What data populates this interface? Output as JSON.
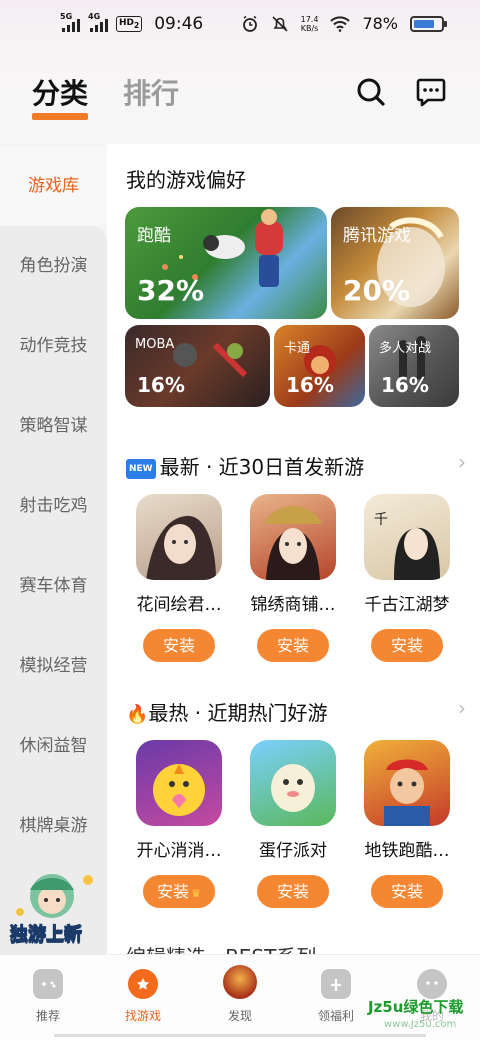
{
  "status_bar": {
    "sim1": "5G",
    "sim2": "4G",
    "hd": "HD",
    "hd_sub": "2",
    "time": "09:46",
    "speed_value": "17.4",
    "speed_unit": "KB/s",
    "battery": "78%"
  },
  "header": {
    "tabs": [
      {
        "label": "分类",
        "active": true
      },
      {
        "label": "排行",
        "active": false
      }
    ],
    "icons": [
      "search-icon",
      "message-icon"
    ]
  },
  "sidebar": {
    "items": [
      "游戏库",
      "角色扮演",
      "动作竞技",
      "策略智谋",
      "射击吃鸡",
      "赛车体育",
      "模拟经营",
      "休闲益智",
      "棋牌桌游"
    ],
    "active_index": 0,
    "badge_label": "独游上新"
  },
  "preference": {
    "title": "我的游戏偏好",
    "tiles": [
      {
        "name": "跑酷",
        "percent": "32%"
      },
      {
        "name": "腾讯游戏",
        "percent": "20%"
      },
      {
        "name": "MOBA",
        "percent": "16%"
      },
      {
        "name": "卡通",
        "percent": "16%"
      },
      {
        "name": "多人对战",
        "percent": "16%"
      }
    ]
  },
  "new_section": {
    "badge": "NEW",
    "title": "最新 · 近30日首发新游",
    "games": [
      {
        "name": "花间绘君…",
        "button": "安装"
      },
      {
        "name": "锦绣商铺…",
        "button": "安装"
      },
      {
        "name": "千古江湖梦",
        "button": "安装"
      }
    ]
  },
  "hot_section": {
    "emoji": "🔥",
    "title": "最热 · 近期热门好游",
    "games": [
      {
        "name": "开心消消…",
        "button": "安装",
        "crown": "♛"
      },
      {
        "name": "蛋仔派对",
        "button": "安装"
      },
      {
        "name": "地铁跑酷…",
        "button": "安装"
      }
    ]
  },
  "partial_section": {
    "title": "编辑精选 · BEST系列"
  },
  "bottom_nav": [
    {
      "label": "推荐"
    },
    {
      "label": "找游戏",
      "active": true
    },
    {
      "label": "发现"
    },
    {
      "label": "领福利"
    },
    {
      "label": "我的"
    }
  ],
  "watermark": {
    "main": "Jz5u绿色下载",
    "sub": "www.Jz5u.com"
  },
  "colors": {
    "accent": "#f07a26",
    "install_button": "#f58632",
    "active_text": "#e9631a"
  }
}
